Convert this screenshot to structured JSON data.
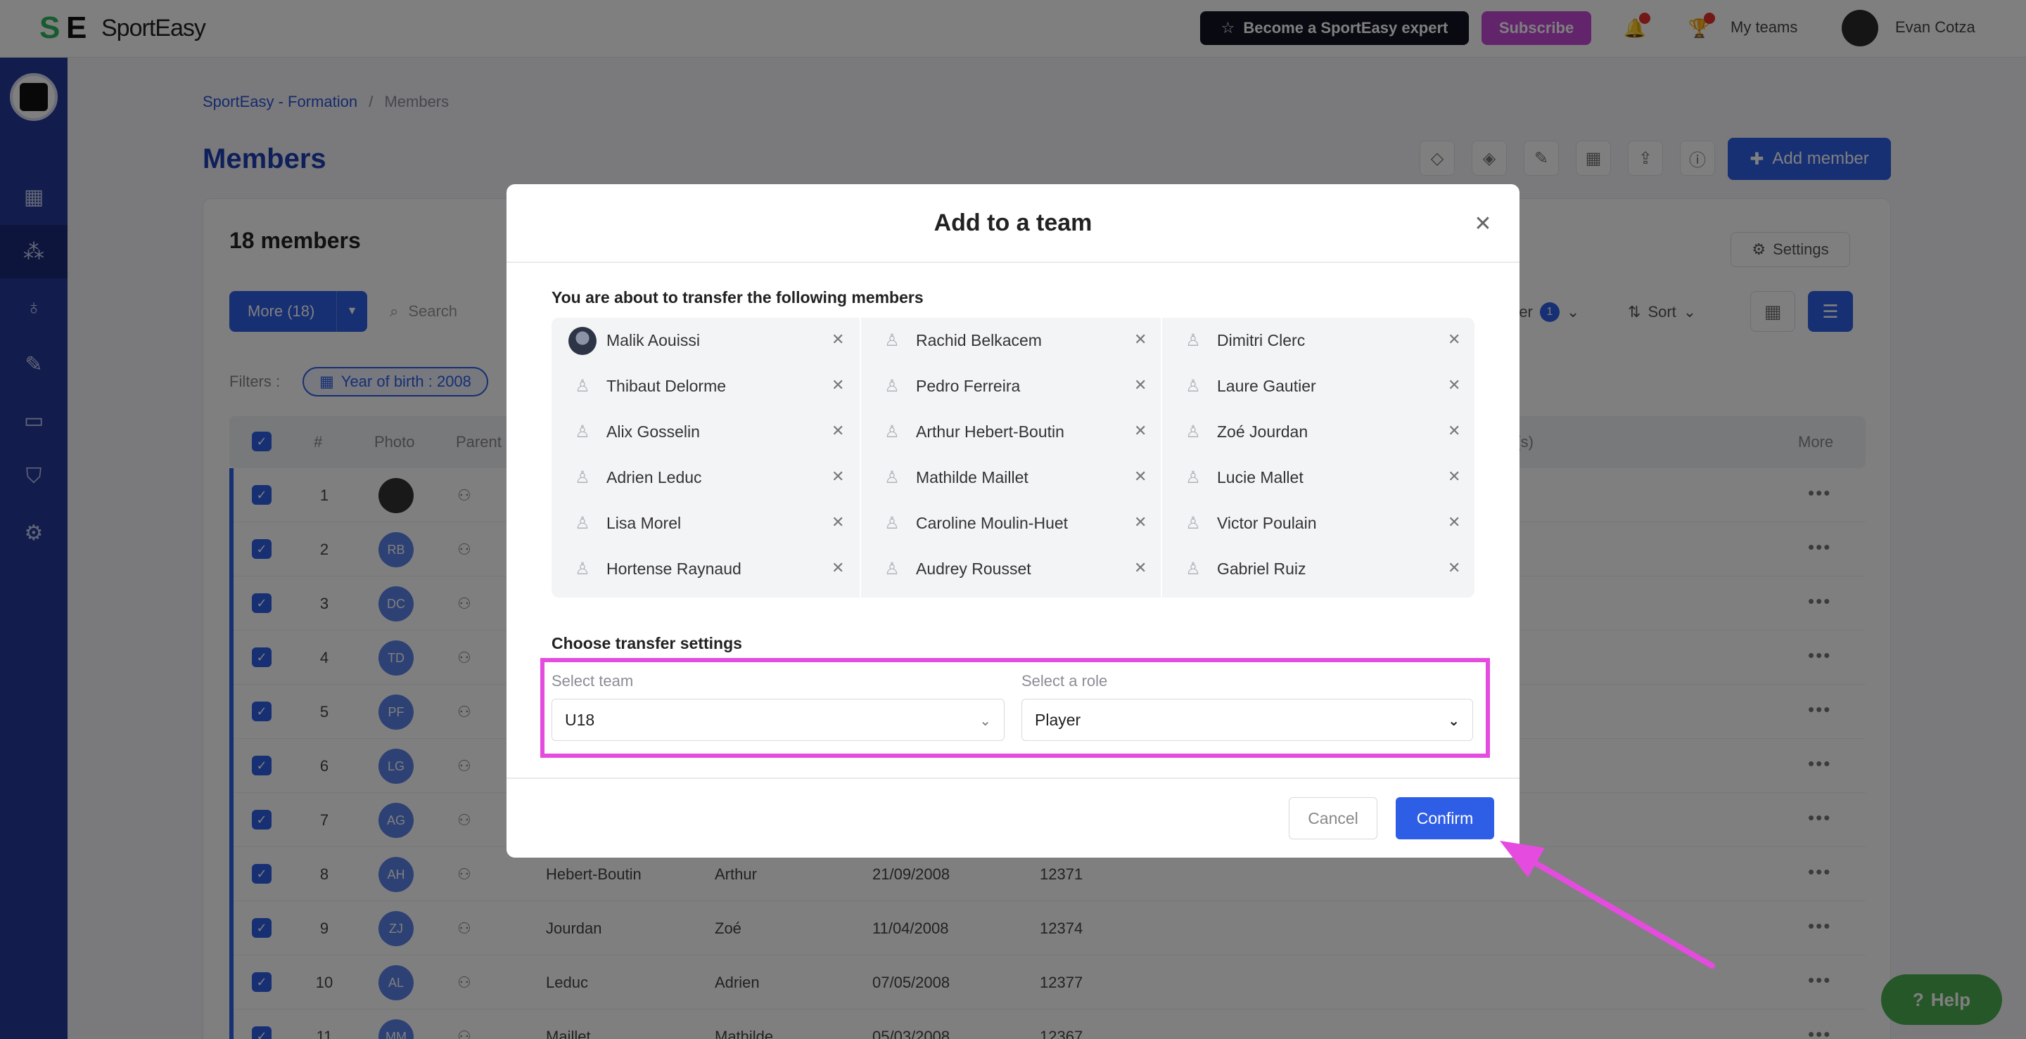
{
  "topbar": {
    "logo_text": "SportEasy",
    "expert_label": "Become a SportEasy expert",
    "subscribe_label": "Subscribe",
    "my_teams_label": "My teams",
    "user_name": "Evan Cotza"
  },
  "breadcrumb": {
    "club": "SportEasy - Formation",
    "separator": "/",
    "current": "Members"
  },
  "page": {
    "title": "Members",
    "add_member_label": "Add member"
  },
  "toolbar": {
    "members_count": "18 members",
    "settings_label": "Settings",
    "more_label": "More (18)",
    "search_placeholder": "Search",
    "filter_label": "Filter",
    "filter_count": "1",
    "sort_label": "Sort",
    "filters_label": "Filters :",
    "chip_label": "Year of birth : 2008"
  },
  "table": {
    "headers": {
      "num": "#",
      "photo": "Photo",
      "parents": "Parent",
      "team": "m(s)",
      "more": "More"
    },
    "rows": [
      {
        "num": "1",
        "initials": "",
        "last": "",
        "first": "",
        "dob": "",
        "id": ""
      },
      {
        "num": "2",
        "initials": "RB",
        "last": "",
        "first": "",
        "dob": "",
        "id": ""
      },
      {
        "num": "3",
        "initials": "DC",
        "last": "",
        "first": "",
        "dob": "",
        "id": ""
      },
      {
        "num": "4",
        "initials": "TD",
        "last": "",
        "first": "",
        "dob": "",
        "id": ""
      },
      {
        "num": "5",
        "initials": "PF",
        "last": "",
        "first": "",
        "dob": "",
        "id": ""
      },
      {
        "num": "6",
        "initials": "LG",
        "last": "",
        "first": "",
        "dob": "",
        "id": ""
      },
      {
        "num": "7",
        "initials": "AG",
        "last": "",
        "first": "",
        "dob": "",
        "id": ""
      },
      {
        "num": "8",
        "initials": "AH",
        "last": "Hebert-Boutin",
        "first": "Arthur",
        "dob": "21/09/2008",
        "id": "12371"
      },
      {
        "num": "9",
        "initials": "ZJ",
        "last": "Jourdan",
        "first": "Zoé",
        "dob": "11/04/2008",
        "id": "12374"
      },
      {
        "num": "10",
        "initials": "AL",
        "last": "Leduc",
        "first": "Adrien",
        "dob": "07/05/2008",
        "id": "12377"
      },
      {
        "num": "11",
        "initials": "MM",
        "last": "Maillet",
        "first": "Mathilde",
        "dob": "05/03/2008",
        "id": "12367"
      }
    ]
  },
  "help_label": "Help",
  "modal": {
    "title": "Add to a team",
    "transfer_label": "You are about to transfer the following members",
    "members": [
      [
        "Malik Aouissi",
        "Thibaut Delorme",
        "Alix Gosselin",
        "Adrien Leduc",
        "Lisa Morel",
        "Hortense Raynaud"
      ],
      [
        "Rachid Belkacem",
        "Pedro Ferreira",
        "Arthur Hebert-Boutin",
        "Mathilde Maillet",
        "Caroline Moulin-Huet",
        "Audrey Rousset"
      ],
      [
        "Dimitri Clerc",
        "Laure Gautier",
        "Zoé Jourdan",
        "Lucie Mallet",
        "Victor Poulain",
        "Gabriel Ruiz"
      ]
    ],
    "settings_label": "Choose transfer settings",
    "team_label": "Select team",
    "team_value": "U18",
    "role_label": "Select a role",
    "role_value": "Player",
    "cancel_label": "Cancel",
    "confirm_label": "Confirm"
  },
  "colors": {
    "primary": "#2f5ee6",
    "sidebar": "#253a9a",
    "highlight": "#e64be0",
    "help": "#4caf50"
  }
}
